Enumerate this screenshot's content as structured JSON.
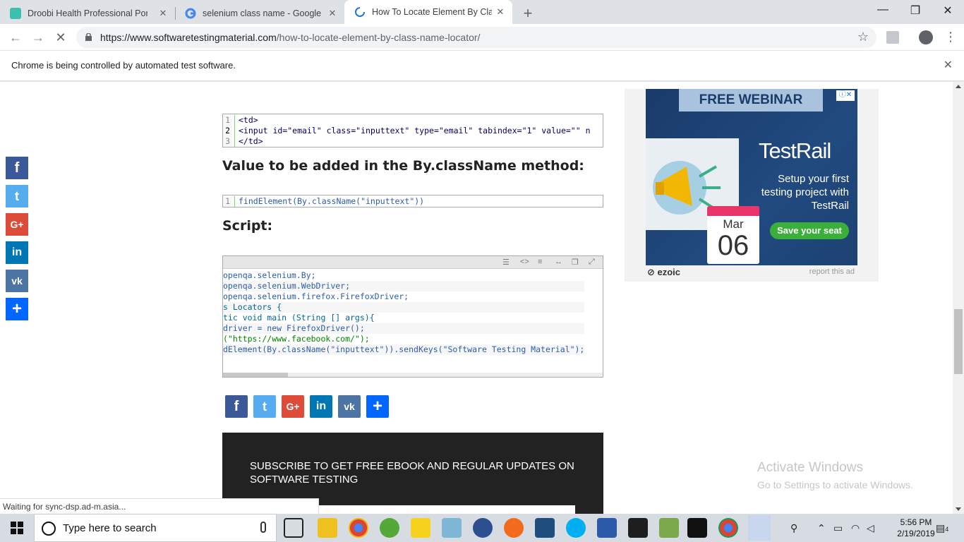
{
  "browser": {
    "tabs": [
      {
        "title": "Droobi Health Professional Portal",
        "active": false
      },
      {
        "title": "selenium class name - Google Se",
        "active": false
      },
      {
        "title": "How To Locate Element By Class",
        "active": true
      }
    ],
    "new_tab_label": "+",
    "url_domain": "https://www.softwaretestingmaterial.com",
    "url_path": "/how-to-locate-element-by-class-name-locator/",
    "infobar_text": "Chrome is being controlled by automated test software.",
    "status_text": "Waiting for sync-dsp.ad-m.asia..."
  },
  "article": {
    "code1": {
      "lines": [
        {
          "n": "1",
          "code": "<td>"
        },
        {
          "n": "2",
          "code": "<input id=\"email\" class=\"inputtext\" type=\"email\" tabindex=\"1\" value=\"\" n"
        },
        {
          "n": "3",
          "code": "</td>"
        }
      ]
    },
    "heading_value": "Value to be added in the By.className method:",
    "code2": {
      "lines": [
        {
          "n": "1",
          "code": "findElement(By.className(\"inputtext\"))"
        }
      ]
    },
    "heading_script": "Script:",
    "script_lines": [
      "openqa.selenium.By;",
      "openqa.selenium.WebDriver;",
      "openqa.selenium.firefox.FirefoxDriver;",
      "s Locators {",
      "tic void main (String [] args){",
      "driver = new FirefoxDriver();",
      "(\"https://www.facebook.com/\");",
      "dElement(By.className(\"inputtext\")).sendKeys(\"Software Testing Material\");"
    ],
    "subscribe_text": "SUBSCRIBE TO GET FREE EBOOK AND REGULAR UPDATES ON SOFTWARE TESTING"
  },
  "share": {
    "items": [
      {
        "name": "facebook",
        "glyph": "f",
        "color": "#3b5998"
      },
      {
        "name": "twitter",
        "glyph": "t",
        "color": "#55acee"
      },
      {
        "name": "google-plus",
        "glyph": "G+",
        "color": "#dd4b39"
      },
      {
        "name": "linkedin",
        "glyph": "in",
        "color": "#0077b5"
      },
      {
        "name": "vk",
        "glyph": "vk",
        "color": "#4c75a3"
      },
      {
        "name": "share",
        "glyph": "+",
        "color": "#0166ff"
      }
    ]
  },
  "ad": {
    "banner": "FREE WEBINAR",
    "brand": "TestRail",
    "tagline": "Setup your first testing project with TestRail",
    "cta": "Save your seat",
    "month": "Mar",
    "day": "06",
    "provider": "ezoic",
    "report": "report this ad"
  },
  "watermark": {
    "title": "Activate Windows",
    "subtitle": "Go to Settings to activate Windows."
  },
  "taskbar": {
    "search_placeholder": "Type here to search",
    "time": "5:56 PM",
    "date": "2/19/2019",
    "notification_count": "4"
  }
}
